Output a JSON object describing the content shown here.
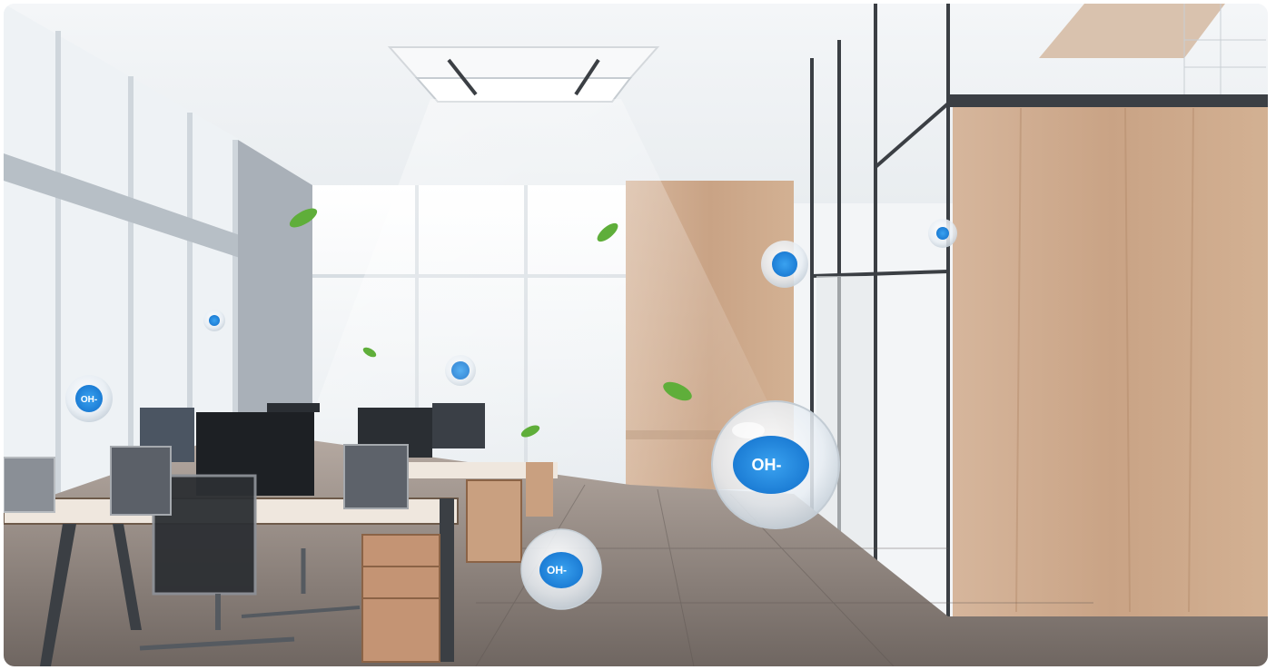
{
  "scene": {
    "subject": "office-interior",
    "ion_label": "OH-",
    "colors": {
      "ion_blue": "#1e8ee6",
      "leaf_green": "#5fae3a",
      "wood": "#c9a385",
      "floor": "#8a7f78",
      "frame_dark": "#3b3f44"
    }
  }
}
